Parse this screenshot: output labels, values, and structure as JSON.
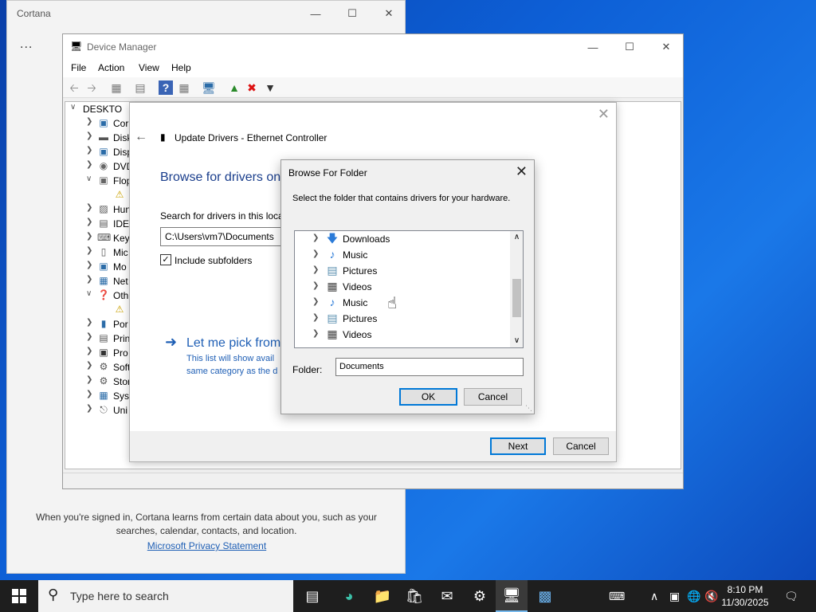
{
  "cortana": {
    "title": "Cortana",
    "more": "...",
    "info": "When you're signed in, Cortana learns from certain data about you, such as your searches, calendar, contacts, and location.",
    "privacy_link": "Microsoft Privacy Statement"
  },
  "devmgr": {
    "title": "Device Manager",
    "menu": [
      "File",
      "Action",
      "View",
      "Help"
    ],
    "root": "DESKTO",
    "tree": [
      "Cor",
      "Disk",
      "Disp",
      "DVD",
      "Flop",
      "",
      "Hun",
      "IDE",
      "Key",
      "Mic",
      "Mo",
      "Net",
      "Oth",
      "",
      "Por",
      "Prin",
      "Pro",
      "Soft",
      "Stor",
      "Syst",
      "Uni"
    ]
  },
  "update_drivers": {
    "title": "Update Drivers - Ethernet Controller",
    "heading": "Browse for drivers on",
    "search_label": "Search for drivers in this locat",
    "path_value": "C:\\Users\\vm7\\Documents",
    "include_subfolders": "Include subfolders",
    "pick_title": "Let me pick from",
    "pick_desc": "This list will show avail same category as the d",
    "next": "Next",
    "cancel": "Cancel"
  },
  "browse_folder": {
    "title": "Browse For Folder",
    "instruction": "Select the folder that contains drivers for your hardware.",
    "items": [
      {
        "label": "Downloads",
        "icon": "download-icon",
        "color": "#2b7bd8"
      },
      {
        "label": "Music",
        "icon": "music-icon",
        "color": "#2b7bd8"
      },
      {
        "label": "Pictures",
        "icon": "picture-icon",
        "color": "#5a8fb0"
      },
      {
        "label": "Videos",
        "icon": "video-icon",
        "color": "#444444"
      },
      {
        "label": "Music",
        "icon": "music-icon",
        "color": "#2b7bd8"
      },
      {
        "label": "Pictures",
        "icon": "picture-icon",
        "color": "#5a8fb0"
      },
      {
        "label": "Videos",
        "icon": "video-icon",
        "color": "#444444"
      }
    ],
    "folder_label": "Folder:",
    "folder_value": "Documents",
    "ok": "OK",
    "cancel": "Cancel"
  },
  "taskbar": {
    "search_placeholder": "Type here to search",
    "time": "8:10 PM",
    "date": "11/30/2025"
  }
}
